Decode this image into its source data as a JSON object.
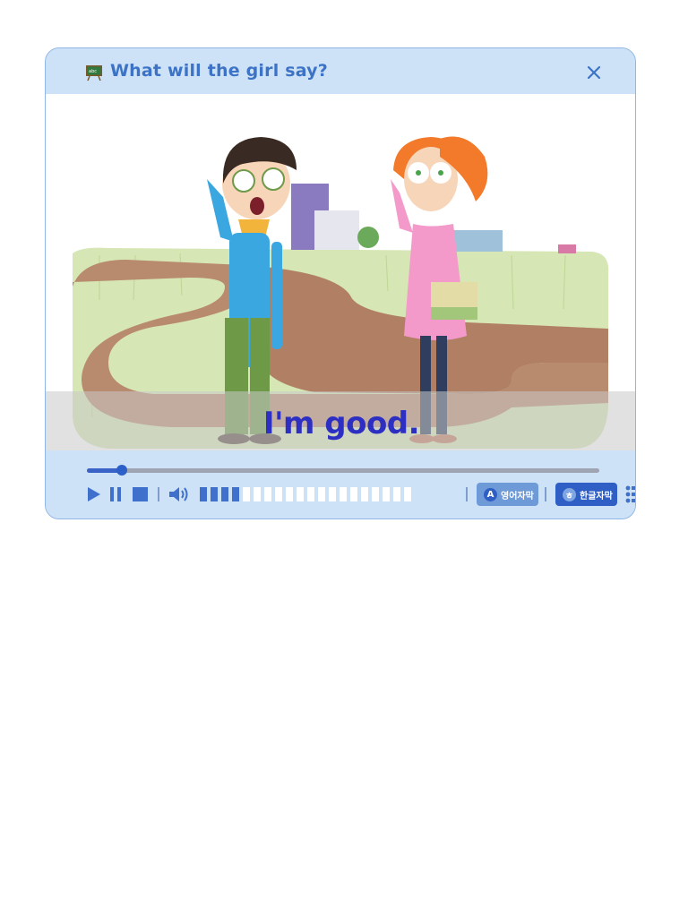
{
  "header": {
    "title": "What will the girl say?"
  },
  "video": {
    "subtitle": "I'm good."
  },
  "controls": {
    "progress": 0.068,
    "volume_level": 0.19,
    "volume_segments": 20,
    "english_caption": {
      "badge": "A",
      "label": "영어자막"
    },
    "korean_caption": {
      "badge": "ㅎ",
      "label": "한글자막"
    }
  },
  "colors": {
    "accent": "#3c73c6",
    "panel": "#cde2f7",
    "border": "#8fb6e6",
    "subtitle": "#2d2fc2",
    "english_pill": "#6f9ad8",
    "korean_pill": "#2f5fc4"
  }
}
